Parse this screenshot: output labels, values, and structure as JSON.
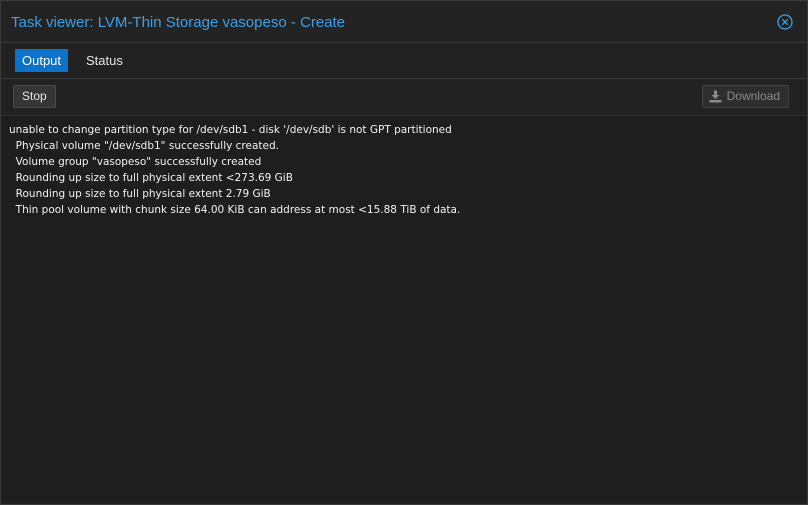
{
  "window": {
    "title": "Task viewer: LVM-Thin Storage vasopeso - Create"
  },
  "tabs": [
    {
      "label": "Output",
      "active": true
    },
    {
      "label": "Status",
      "active": false
    }
  ],
  "toolbar": {
    "stop_label": "Stop",
    "download_label": "Download"
  },
  "log": {
    "lines": [
      "unable to change partition type for /dev/sdb1 - disk '/dev/sdb' is not GPT partitioned",
      "  Physical volume \"/dev/sdb1\" successfully created.",
      "  Volume group \"vasopeso\" successfully created",
      "  Rounding up size to full physical extent <273.69 GiB",
      "  Rounding up size to full physical extent 2.79 GiB",
      "  Thin pool volume with chunk size 64.00 KiB can address at most <15.88 TiB of data."
    ]
  },
  "colors": {
    "accent": "#0a72c9",
    "title": "#3aa0e8"
  },
  "icons": {
    "close": "close-circle-icon",
    "download": "download-icon"
  }
}
